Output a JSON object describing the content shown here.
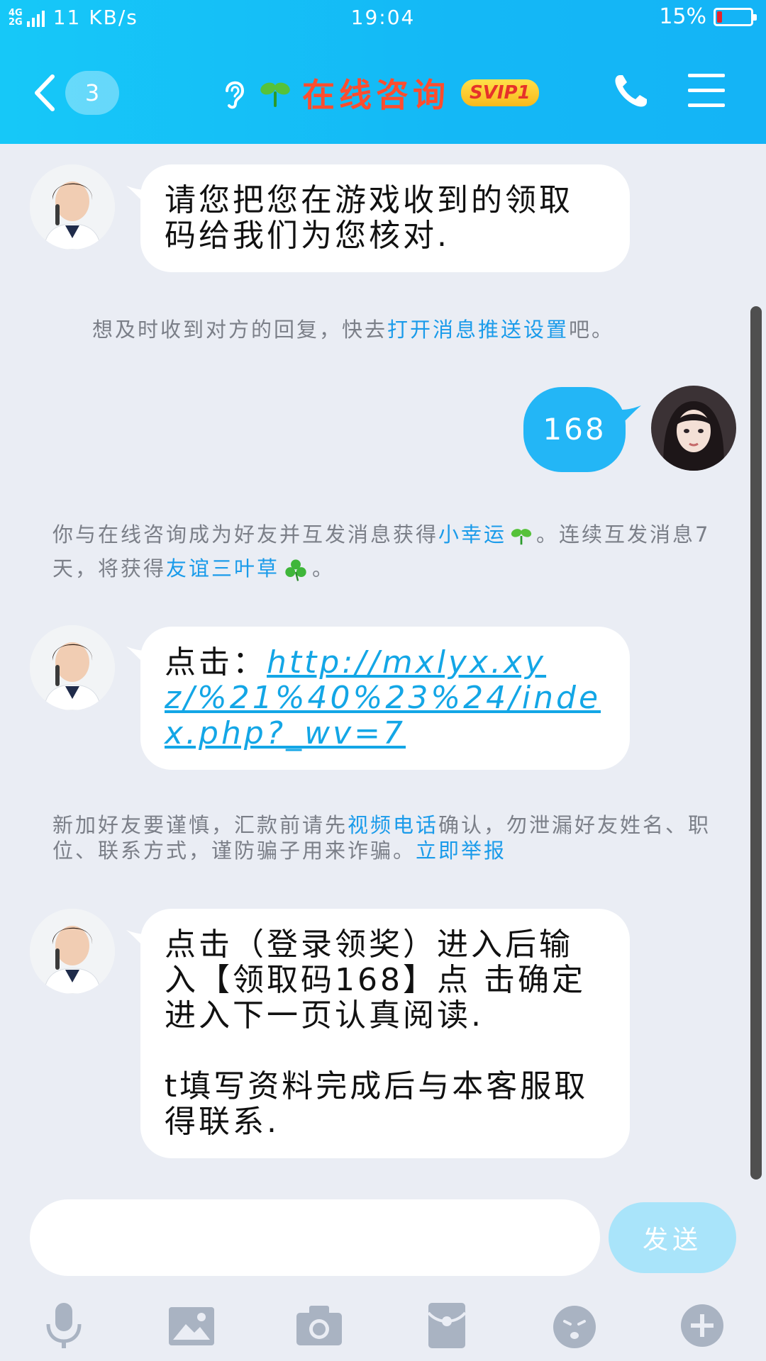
{
  "status_bar": {
    "network_top": "4G",
    "network_bottom": "2G",
    "net_speed": "11 KB/s",
    "time": "19:04",
    "battery": "15%",
    "battery_level": 0.15
  },
  "header": {
    "unread_count": "3",
    "title": "在线咨询",
    "svip": "SVIP1"
  },
  "messages": [
    {
      "from": "agent",
      "text": "请您把您在游戏收到的领取码给我们为您核对."
    },
    {
      "from": "system",
      "parts": [
        "想及时收到对方的回复，快去",
        "打开消息推送设置",
        "吧。"
      ]
    },
    {
      "from": "self",
      "text": "168"
    },
    {
      "from": "system",
      "parts": [
        "你与在线咨询成为好友并互发消息获得",
        "小幸运",
        "。连续互发消息7天，将获得",
        "友谊三叶草",
        "。"
      ]
    },
    {
      "from": "agent",
      "prefix": "点击：",
      "link": "http://mxlyx.xyz/%21%40%23%24/index.php?_wv=7"
    },
    {
      "from": "system",
      "parts": [
        "新加好友要谨慎，汇款前请先",
        "视频电话",
        "确认，勿泄漏好友姓名、职位、联系方式，谨防骗子用来诈骗。",
        "立即举报"
      ]
    },
    {
      "from": "agent",
      "lines": [
        "点击（登录领奖）进入后输入【领取码168】点 击确定进入下一页认真阅读.",
        "t填写资料完成后与本客服取得联系."
      ]
    }
  ],
  "input": {
    "value": "",
    "send_label": "发送"
  },
  "toolbar": [
    "microphone-icon",
    "image-icon",
    "camera-icon",
    "red-packet-icon",
    "emoji-icon",
    "plus-icon"
  ],
  "colors": {
    "accent": "#14b8f6",
    "title": "#ff4d2e",
    "link": "#13a6e6",
    "self_bubble": "#23b6f6"
  }
}
